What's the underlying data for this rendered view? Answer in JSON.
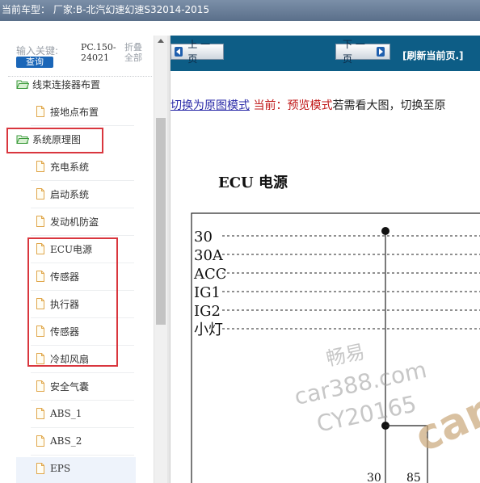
{
  "header": {
    "title": "当前车型：  厂家:B-北汽幻速幻速S32014-2015"
  },
  "sidebar": {
    "search_label": "输入关键:",
    "query_button": "查询",
    "code_text": "PC.150-24021",
    "fold_label": "折叠全部",
    "items": [
      {
        "label": "线束连接器布置",
        "icon": "folder-open-icon",
        "level": 0
      },
      {
        "label": "接地点布置",
        "icon": "page-icon",
        "level": 1
      },
      {
        "label": "系统原理图",
        "icon": "folder-open-icon",
        "level": 0
      },
      {
        "label": "充电系统",
        "icon": "page-icon",
        "level": 1
      },
      {
        "label": "启动系统",
        "icon": "page-icon",
        "level": 1
      },
      {
        "label": "发动机防盗",
        "icon": "page-icon",
        "level": 1
      },
      {
        "label": "ECU电源",
        "icon": "page-icon",
        "level": 1
      },
      {
        "label": "传感器",
        "icon": "page-icon",
        "level": 1
      },
      {
        "label": "执行器",
        "icon": "page-icon",
        "level": 1
      },
      {
        "label": "传感器",
        "icon": "page-icon",
        "level": 1
      },
      {
        "label": "冷却风扇",
        "icon": "page-icon",
        "level": 1
      },
      {
        "label": "安全气囊",
        "icon": "page-icon",
        "level": 1
      },
      {
        "label": "ABS_1",
        "icon": "page-icon",
        "level": 1
      },
      {
        "label": "ABS_2",
        "icon": "page-icon",
        "level": 1
      },
      {
        "label": "EPS",
        "icon": "page-icon",
        "level": 1
      }
    ]
  },
  "viewer": {
    "prev_button": "上 一 页",
    "next_button": "下 一 页",
    "refresh_link": "[刷新当前页.]",
    "mode_link": "切换为原图模式",
    "current_label": "当前：",
    "current_mode": "预览模式",
    "hint_text": "若需看大图，切换至原",
    "diagram_title": "ECU 电源",
    "power_lines": [
      "30",
      "30A",
      "ACC",
      "IG1",
      "IG2",
      "小灯"
    ],
    "pin_labels": [
      "30",
      "85"
    ]
  },
  "watermark": {
    "line1": "畅易",
    "line2": "car388.com",
    "line3": "CY20165",
    "corner": "car"
  },
  "colors": {
    "nav_bg": "#0d5d86",
    "link": "#2a2aa8",
    "current_mode": "#c01818",
    "highlight": "#d9363e",
    "query_button": "#1a66b8"
  }
}
